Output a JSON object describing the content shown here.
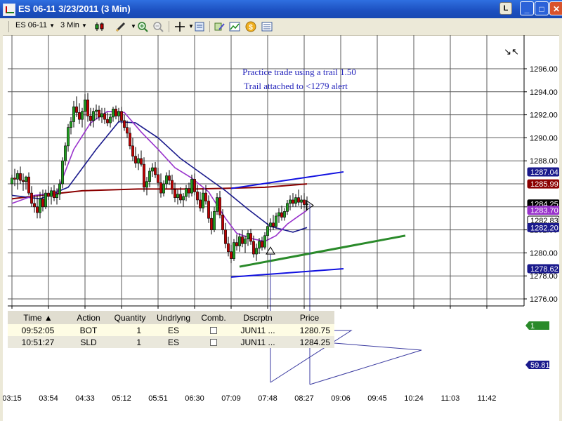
{
  "window": {
    "title": "ES 06-11   3/23/2011 (3 Min)",
    "controls": {
      "lock": "L",
      "minimize": "_",
      "maximize": "□",
      "close": "✕"
    }
  },
  "toolbar": {
    "instrument": "ES 06-11",
    "interval": "3 Min",
    "icons": [
      "candlestick-icon",
      "pencil-icon",
      "zoom-in-icon",
      "zoom-out-icon",
      "crosshair-icon",
      "properties-icon",
      "strategy-icon",
      "indicators-icon",
      "dollar-icon",
      "data-box-icon"
    ]
  },
  "colors": {
    "ma_slow": "#8b0000",
    "ma_mid": "#1a1a8c",
    "ma_fast": "#9933cc",
    "up_candle": "#1f9e1f",
    "down_candle": "#c00000",
    "trend_blue": "#1010e0",
    "trend_green": "#2a8a2a"
  },
  "annotations": [
    "Practice trade using a trail 1.50",
    "Trail attached to <1279 alert"
  ],
  "price_axis": {
    "labels": [
      "1296.00",
      "1294.00",
      "1292.00",
      "1290.00",
      "1288.00",
      "1284.00",
      "1282.00",
      "1280.00",
      "1278.00",
      "1276.00"
    ],
    "tags": [
      {
        "label": "1287.04",
        "price": 1287.04,
        "color": "#1a1a8c"
      },
      {
        "label": "1285.99",
        "price": 1285.99,
        "color": "#8b0000"
      },
      {
        "label": "1284.25",
        "price": 1284.25,
        "color": "#000000"
      },
      {
        "label": "1283.70",
        "price": 1283.7,
        "color": "#9933cc"
      },
      {
        "label": "1282.83",
        "price": 1282.83,
        "color": "#ffffff"
      },
      {
        "label": "1282.20",
        "price": 1282.2,
        "color": "#1a1a8c"
      },
      {
        "label": "1278.62",
        "price": 1278.62,
        "color": "#1a1a8c"
      }
    ],
    "side_badges": [
      {
        "label": "1",
        "color": "#2a8a2a"
      },
      {
        "label": "59.81",
        "color": "#1a1a8c"
      }
    ]
  },
  "time_axis": {
    "labels": [
      "03:15",
      "03:54",
      "04:33",
      "05:12",
      "05:51",
      "06:30",
      "07:09",
      "07:48",
      "08:27",
      "09:06",
      "09:45",
      "10:24",
      "11:03",
      "11:42"
    ]
  },
  "trades": {
    "headers": [
      "Time",
      "Action",
      "Quantity",
      "Undrlyng",
      "Comb.",
      "Dscrptn",
      "Price"
    ],
    "sort_indicator": "▲",
    "rows": [
      {
        "time": "09:52:05",
        "action": "BOT",
        "quantity": "1",
        "underlying": "ES",
        "description": "JUN11 ...",
        "price": "1280.75"
      },
      {
        "time": "10:51:27",
        "action": "SLD",
        "quantity": "1",
        "underlying": "ES",
        "description": "JUN11 ...",
        "price": "1284.25"
      }
    ]
  },
  "chart_data": {
    "type": "candlestick",
    "instrument": "ES 06-11",
    "interval": "3 Min",
    "date": "3/23/2011",
    "ylim": [
      1275.5,
      1297
    ],
    "x_ticks": [
      "03:15",
      "03:54",
      "04:33",
      "05:12",
      "05:51",
      "06:30",
      "07:09",
      "07:48",
      "08:27",
      "09:06",
      "09:45",
      "10:24",
      "11:03",
      "11:42"
    ],
    "candles": [
      [
        1286.0,
        1286.8,
        1285.0,
        1286.5
      ],
      [
        1286.5,
        1287.3,
        1285.8,
        1286.4
      ],
      [
        1286.4,
        1287.2,
        1285.5,
        1286.9
      ],
      [
        1286.9,
        1287.5,
        1286.0,
        1286.3
      ],
      [
        1286.3,
        1286.9,
        1285.4,
        1286.2
      ],
      [
        1286.2,
        1286.7,
        1285.5,
        1286.6
      ],
      [
        1286.6,
        1287.0,
        1285.0,
        1285.2
      ],
      [
        1285.2,
        1285.8,
        1284.0,
        1284.3
      ],
      [
        1284.3,
        1285.0,
        1283.5,
        1284.0
      ],
      [
        1284.0,
        1285.0,
        1283.0,
        1283.5
      ],
      [
        1283.5,
        1285.3,
        1283.0,
        1284.7
      ],
      [
        1284.7,
        1285.5,
        1283.6,
        1284.0
      ],
      [
        1284.0,
        1285.5,
        1283.8,
        1285.2
      ],
      [
        1285.2,
        1285.8,
        1284.6,
        1284.9
      ],
      [
        1284.9,
        1285.7,
        1284.2,
        1285.4
      ],
      [
        1285.4,
        1285.9,
        1284.5,
        1284.8
      ],
      [
        1284.8,
        1285.6,
        1284.2,
        1285.1
      ],
      [
        1285.1,
        1286.4,
        1284.6,
        1286.0
      ],
      [
        1286.0,
        1288.3,
        1285.6,
        1288.0
      ],
      [
        1288.0,
        1289.6,
        1287.6,
        1289.3
      ],
      [
        1289.3,
        1291.2,
        1288.8,
        1290.9
      ],
      [
        1290.9,
        1291.8,
        1290.3,
        1291.4
      ],
      [
        1291.4,
        1293.2,
        1290.9,
        1292.7
      ],
      [
        1292.7,
        1293.6,
        1291.8,
        1292.2
      ],
      [
        1292.2,
        1293.0,
        1291.2,
        1291.6
      ],
      [
        1291.6,
        1292.6,
        1290.9,
        1292.3
      ],
      [
        1292.3,
        1293.8,
        1291.9,
        1293.3
      ],
      [
        1293.3,
        1293.9,
        1291.4,
        1291.9
      ],
      [
        1291.9,
        1292.6,
        1291.0,
        1291.5
      ],
      [
        1291.5,
        1292.6,
        1290.9,
        1292.3
      ],
      [
        1292.3,
        1292.9,
        1291.6,
        1292.4
      ],
      [
        1292.4,
        1292.8,
        1291.5,
        1291.8
      ],
      [
        1291.8,
        1292.6,
        1291.3,
        1292.1
      ],
      [
        1292.1,
        1292.6,
        1291.2,
        1291.6
      ],
      [
        1291.6,
        1292.2,
        1291.0,
        1291.3
      ],
      [
        1291.3,
        1292.1,
        1290.9,
        1291.8
      ],
      [
        1291.8,
        1292.7,
        1291.4,
        1292.5
      ],
      [
        1292.5,
        1292.8,
        1291.6,
        1291.9
      ],
      [
        1291.9,
        1292.6,
        1291.4,
        1292.3
      ],
      [
        1292.3,
        1292.7,
        1291.2,
        1291.5
      ],
      [
        1291.5,
        1292.0,
        1290.6,
        1290.9
      ],
      [
        1290.9,
        1291.5,
        1290.0,
        1290.4
      ],
      [
        1290.4,
        1290.9,
        1289.0,
        1289.3
      ],
      [
        1289.3,
        1290.0,
        1288.0,
        1288.4
      ],
      [
        1288.4,
        1289.2,
        1287.4,
        1287.8
      ],
      [
        1287.8,
        1288.6,
        1287.2,
        1288.2
      ],
      [
        1288.2,
        1288.9,
        1287.5,
        1287.7
      ],
      [
        1287.7,
        1288.3,
        1285.3,
        1285.7
      ],
      [
        1285.7,
        1286.6,
        1285.0,
        1286.2
      ],
      [
        1286.2,
        1287.4,
        1285.7,
        1287.1
      ],
      [
        1287.1,
        1287.8,
        1286.6,
        1287.4
      ],
      [
        1287.4,
        1287.9,
        1286.5,
        1286.8
      ],
      [
        1286.8,
        1287.4,
        1285.8,
        1286.1
      ],
      [
        1286.1,
        1286.9,
        1284.8,
        1285.2
      ],
      [
        1285.2,
        1286.3,
        1284.9,
        1286.0
      ],
      [
        1286.0,
        1287.0,
        1285.6,
        1286.7
      ],
      [
        1286.7,
        1287.2,
        1285.9,
        1286.3
      ],
      [
        1286.3,
        1286.8,
        1285.1,
        1285.5
      ],
      [
        1285.5,
        1286.1,
        1284.4,
        1284.8
      ],
      [
        1284.8,
        1285.5,
        1284.2,
        1285.1
      ],
      [
        1285.1,
        1285.7,
        1284.3,
        1284.6
      ],
      [
        1284.6,
        1285.2,
        1284.0,
        1284.9
      ],
      [
        1284.9,
        1285.9,
        1284.5,
        1285.6
      ],
      [
        1285.6,
        1286.1,
        1284.8,
        1285.2
      ],
      [
        1285.2,
        1286.8,
        1284.9,
        1286.4
      ],
      [
        1286.4,
        1286.9,
        1285.0,
        1285.3
      ],
      [
        1285.3,
        1285.9,
        1284.2,
        1284.6
      ],
      [
        1284.6,
        1285.3,
        1283.6,
        1283.9
      ],
      [
        1283.9,
        1285.6,
        1283.5,
        1285.2
      ],
      [
        1285.2,
        1285.9,
        1284.2,
        1284.5
      ],
      [
        1284.5,
        1285.0,
        1282.6,
        1283.0
      ],
      [
        1283.0,
        1283.6,
        1281.6,
        1282.0
      ],
      [
        1282.0,
        1284.0,
        1281.8,
        1283.6
      ],
      [
        1283.6,
        1285.2,
        1283.3,
        1284.8
      ],
      [
        1284.8,
        1285.4,
        1283.0,
        1283.3
      ],
      [
        1283.3,
        1283.8,
        1281.6,
        1282.0
      ],
      [
        1282.0,
        1282.6,
        1280.4,
        1280.8
      ],
      [
        1280.8,
        1281.4,
        1279.7,
        1280.1
      ],
      [
        1280.1,
        1280.7,
        1279.1,
        1279.5
      ],
      [
        1279.5,
        1281.2,
        1279.3,
        1280.9
      ],
      [
        1280.9,
        1281.6,
        1280.2,
        1280.6
      ],
      [
        1280.6,
        1281.7,
        1280.1,
        1281.4
      ],
      [
        1281.4,
        1282.0,
        1280.5,
        1280.8
      ],
      [
        1280.8,
        1281.5,
        1280.0,
        1281.2
      ],
      [
        1281.2,
        1282.0,
        1280.6,
        1281.7
      ],
      [
        1281.7,
        1282.1,
        1280.7,
        1281.0
      ],
      [
        1281.0,
        1281.5,
        1279.6,
        1279.9
      ],
      [
        1279.9,
        1280.8,
        1279.3,
        1280.4
      ],
      [
        1280.4,
        1281.3,
        1279.9,
        1281.0
      ],
      [
        1281.0,
        1281.4,
        1280.2,
        1280.5
      ],
      [
        1280.5,
        1281.8,
        1280.3,
        1281.5
      ],
      [
        1281.5,
        1282.6,
        1281.1,
        1282.3
      ],
      [
        1282.3,
        1283.0,
        1281.8,
        1282.6
      ],
      [
        1282.6,
        1283.3,
        1282.0,
        1282.3
      ],
      [
        1282.3,
        1283.5,
        1282.1,
        1283.2
      ],
      [
        1283.2,
        1283.9,
        1282.6,
        1283.5
      ],
      [
        1283.5,
        1284.1,
        1282.8,
        1283.1
      ],
      [
        1283.1,
        1283.9,
        1282.8,
        1283.6
      ],
      [
        1283.6,
        1284.6,
        1283.3,
        1284.3
      ],
      [
        1284.3,
        1285.0,
        1283.7,
        1284.6
      ],
      [
        1284.6,
        1285.2,
        1284.0,
        1284.3
      ],
      [
        1284.3,
        1285.1,
        1284.0,
        1284.8
      ],
      [
        1284.8,
        1285.5,
        1284.1,
        1284.4
      ],
      [
        1284.4,
        1285.0,
        1283.8,
        1284.6
      ],
      [
        1284.6,
        1285.2,
        1283.9,
        1284.2
      ],
      [
        1284.2,
        1284.9,
        1283.7,
        1284.25
      ]
    ],
    "moving_averages": [
      {
        "color": "#8b0000",
        "values": [
          [
            0,
            1284.7
          ],
          [
            10,
            1285.0
          ],
          [
            25,
            1285.4
          ],
          [
            45,
            1285.55
          ],
          [
            65,
            1285.55
          ],
          [
            75,
            1285.6
          ],
          [
            90,
            1285.7
          ],
          [
            105,
            1285.99
          ]
        ]
      },
      {
        "color": "#1a1a8c",
        "values": [
          [
            0,
            1285.0
          ],
          [
            10,
            1284.7
          ],
          [
            20,
            1285.7
          ],
          [
            30,
            1289.0
          ],
          [
            38,
            1291.4
          ],
          [
            44,
            1291.3
          ],
          [
            52,
            1290.0
          ],
          [
            60,
            1288.2
          ],
          [
            68,
            1286.8
          ],
          [
            76,
            1285.4
          ],
          [
            84,
            1283.8
          ],
          [
            92,
            1282.3
          ],
          [
            100,
            1281.8
          ],
          [
            105,
            1282.2
          ]
        ]
      },
      {
        "color": "#9933cc",
        "values": [
          [
            0,
            1284.3
          ],
          [
            8,
            1285.0
          ],
          [
            16,
            1285.2
          ],
          [
            22,
            1289.0
          ],
          [
            28,
            1291.3
          ],
          [
            34,
            1292.3
          ],
          [
            40,
            1292.2
          ],
          [
            46,
            1290.5
          ],
          [
            52,
            1289.0
          ],
          [
            58,
            1287.4
          ],
          [
            64,
            1286.5
          ],
          [
            70,
            1285.3
          ],
          [
            76,
            1283.0
          ],
          [
            80,
            1281.7
          ],
          [
            86,
            1281.2
          ],
          [
            90,
            1281.0
          ],
          [
            94,
            1281.5
          ],
          [
            98,
            1282.5
          ],
          [
            102,
            1283.2
          ],
          [
            105,
            1283.7
          ]
        ]
      }
    ],
    "trend_lines": [
      {
        "color": "#1010e0",
        "from": [
          78,
          1285.6
        ],
        "to": [
          118,
          1287.04
        ]
      },
      {
        "color": "#1010e0",
        "from": [
          78,
          1277.9
        ],
        "to": [
          118,
          1278.62
        ]
      },
      {
        "color": "#2a8a2a",
        "from": [
          81,
          1278.8
        ],
        "to": [
          140,
          1281.5
        ]
      }
    ],
    "trade_markers": [
      {
        "time": "09:52:05",
        "action": "BOT",
        "price": 1280.75,
        "bar": 92
      },
      {
        "time": "10:51:27",
        "action": "SLD",
        "price": 1284.25,
        "bar": 106
      }
    ]
  }
}
